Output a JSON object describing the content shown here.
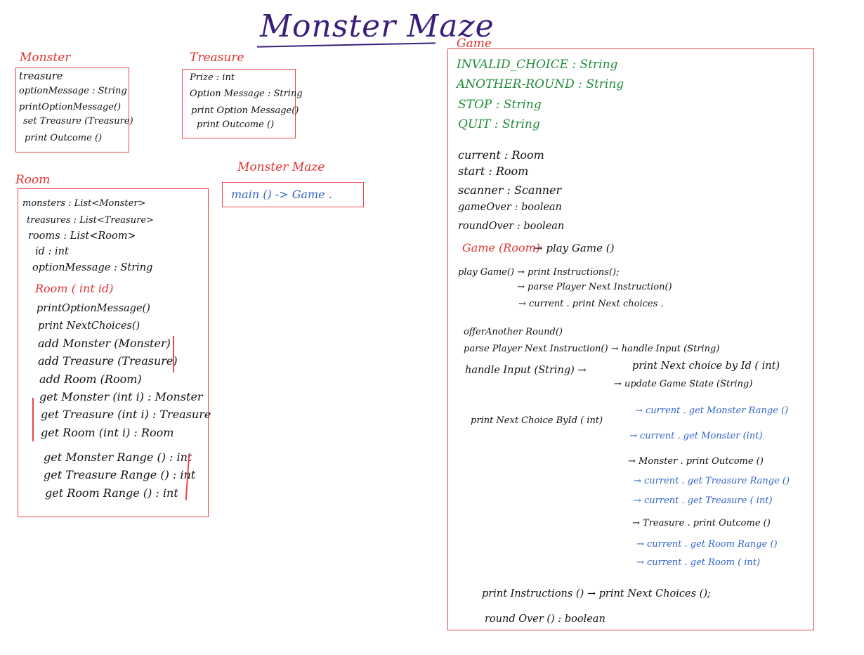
{
  "title": "Monster Maze",
  "monster_class": {
    "name": "Monster",
    "members": [
      "treasure",
      "optionMessage : String",
      "printOptionMessage()",
      "set Treasure (Treasure)",
      "print Outcome ()"
    ]
  },
  "treasure_class": {
    "name": "Treasure",
    "members": [
      "Prize : int",
      "Option Message : String",
      "print Option Message()",
      "print Outcome ()"
    ]
  },
  "room_class": {
    "name": "Room",
    "fields": [
      "monsters : List<Monster>",
      "treasures : List<Treasure>",
      "rooms : List<Room>",
      "id : int",
      "optionMessage : String"
    ],
    "constructor": "Room ( int id)",
    "methods": [
      "printOptionMessage()",
      "print NextChoices()",
      "add Monster (Monster)",
      "add Treasure (Treasure)",
      "add Room (Room)",
      "get Monster (int i) : Monster",
      "get Treasure (int i) : Treasure",
      "get Room (int i) : Room",
      "get Monster Range () : int",
      "get Treasure Range () : int",
      "get Room Range () : int"
    ]
  },
  "maze_class": {
    "name": "Monster Maze",
    "members": [
      "main () -> Game ."
    ]
  },
  "game_class": {
    "name": "Game",
    "constants": [
      "INVALID_CHOICE : String",
      "ANOTHER-ROUND : String",
      "STOP : String",
      "QUIT : String"
    ],
    "fields": [
      "current : Room",
      "start : Room",
      "scanner : Scanner",
      "gameOver : boolean",
      "roundOver : boolean"
    ],
    "constructor": "Game (Room)",
    "constructor_call": "→ play Game ()",
    "play_game": {
      "name": "play Game()",
      "calls": [
        "→ print Instructions();",
        "→ parse Player Next Instruction()",
        "→ current . print Next choices ."
      ]
    },
    "methods": [
      "offerAnother Round()",
      "parse Player Next Instruction() → handle Input (String)",
      "handle Input (String) →",
      "print Next choice by Id ( int)",
      "→ update Game State (String)"
    ],
    "print_next": {
      "name": "print Next Choice ById ( int)",
      "calls": [
        {
          "text": "→ current . get Monster Range ()",
          "color": "blue"
        },
        {
          "text": "→ current . get Monster (int)",
          "color": "blue"
        },
        {
          "text": "→ Monster . print Outcome ()",
          "color": "black"
        },
        {
          "text": "→ current . get Treasure Range ()",
          "color": "blue"
        },
        {
          "text": "→ current . get Treasure ( int)",
          "color": "blue"
        },
        {
          "text": "→ Treasure . print Outcome ()",
          "color": "black"
        },
        {
          "text": "→ current . get Room Range ()",
          "color": "blue"
        },
        {
          "text": "→ current . get Room ( int)",
          "color": "blue"
        }
      ]
    },
    "print_instructions": "print Instructions () → print Next Choices ();",
    "round_over": "round Over () : boolean"
  },
  "colors": {
    "red": "#e03232",
    "green": "#1f8a3a",
    "blue": "#2f62c4",
    "title": "#3a1f7a"
  }
}
